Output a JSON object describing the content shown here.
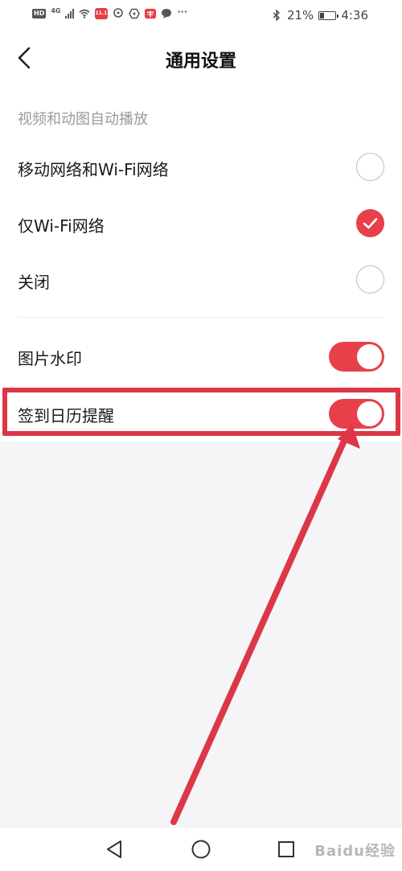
{
  "status_bar": {
    "hd": "HD",
    "network": "4G",
    "app_badge": "11.11",
    "more": "···",
    "battery_percent": "21%",
    "battery_level": 0.21,
    "time": "4:36"
  },
  "header": {
    "title": "通用设置"
  },
  "autoplay": {
    "section_label": "视频和动图自动播放",
    "options": [
      {
        "label": "移动网络和Wi-Fi网络",
        "selected": false
      },
      {
        "label": "仅Wi-Fi网络",
        "selected": true
      },
      {
        "label": "关闭",
        "selected": false
      }
    ]
  },
  "toggles": [
    {
      "label": "图片水印",
      "on": true
    },
    {
      "label": "签到日历提醒",
      "on": true
    }
  ],
  "watermark": {
    "text": "Baidu经验"
  },
  "colors": {
    "accent": "#e8404a",
    "annotation": "#dc3747"
  }
}
